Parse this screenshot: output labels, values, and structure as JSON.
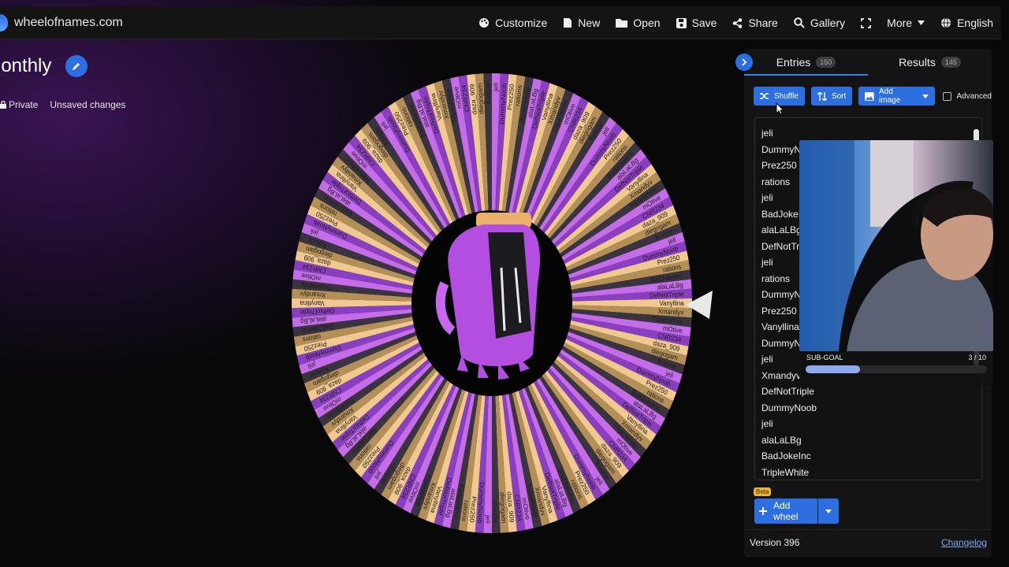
{
  "site": {
    "name": "wheelofnames.com"
  },
  "menu": [
    {
      "label": "Customize",
      "icon": "palette-icon"
    },
    {
      "label": "New",
      "icon": "file-icon"
    },
    {
      "label": "Open",
      "icon": "folder-icon"
    },
    {
      "label": "Save",
      "icon": "save-icon"
    },
    {
      "label": "Share",
      "icon": "share-icon"
    },
    {
      "label": "Gallery",
      "icon": "search-icon"
    },
    {
      "label": "",
      "icon": "fullscreen-icon"
    },
    {
      "label": "More",
      "icon": "caret-down-icon"
    },
    {
      "label": "English",
      "icon": "globe-icon"
    }
  ],
  "wheel": {
    "title": "lonthly",
    "privacy": "Private",
    "status": "Unsaved changes",
    "colors": [
      "#c56ce8",
      "#8a3fc0",
      "#f0c890",
      "#b49058",
      "#3a3340"
    ],
    "segment_labels": [
      "jeli",
      "DummyNoob",
      "Prez250",
      "rations",
      "BadJokeInc",
      "alaLaLBg",
      "DefNotTriple",
      "Vanyllina",
      "Xmandyv",
      "TripleWhite",
      "mOtive",
      "CNR234",
      "daza_909",
      "diegogam",
      "Koozie"
    ]
  },
  "panel": {
    "tabs": [
      {
        "label": "Entries",
        "count": "150"
      },
      {
        "label": "Results",
        "count": "145"
      }
    ],
    "toolbar": {
      "shuffle": "Shuffle",
      "sort": "Sort",
      "add_image": "Add image",
      "advanced": "Advanced"
    },
    "entries": [
      "jeli",
      "DummyN",
      "Prez250",
      "rations",
      "jeli",
      "BadJokeIn",
      "alaLaLBg",
      "DefNotTr",
      "jeli",
      "rations",
      "DummyN",
      "Prez250",
      "Vanyllina",
      "DummyN",
      "jeli",
      "Xmandyv",
      "DefNotTriple",
      "DummyNoob",
      "jeli",
      "alaLaLBg",
      "BadJokeInc",
      "TripleWhite"
    ],
    "add_wheel": {
      "label": "Add wheel",
      "badge": "Beta"
    },
    "version": "Version 396",
    "changelog": "Changelog"
  },
  "overlay": {
    "subgoal_label": "SUB-GOAL",
    "subgoal_count": "3 / 10",
    "subgoal_progress": 0.3
  }
}
